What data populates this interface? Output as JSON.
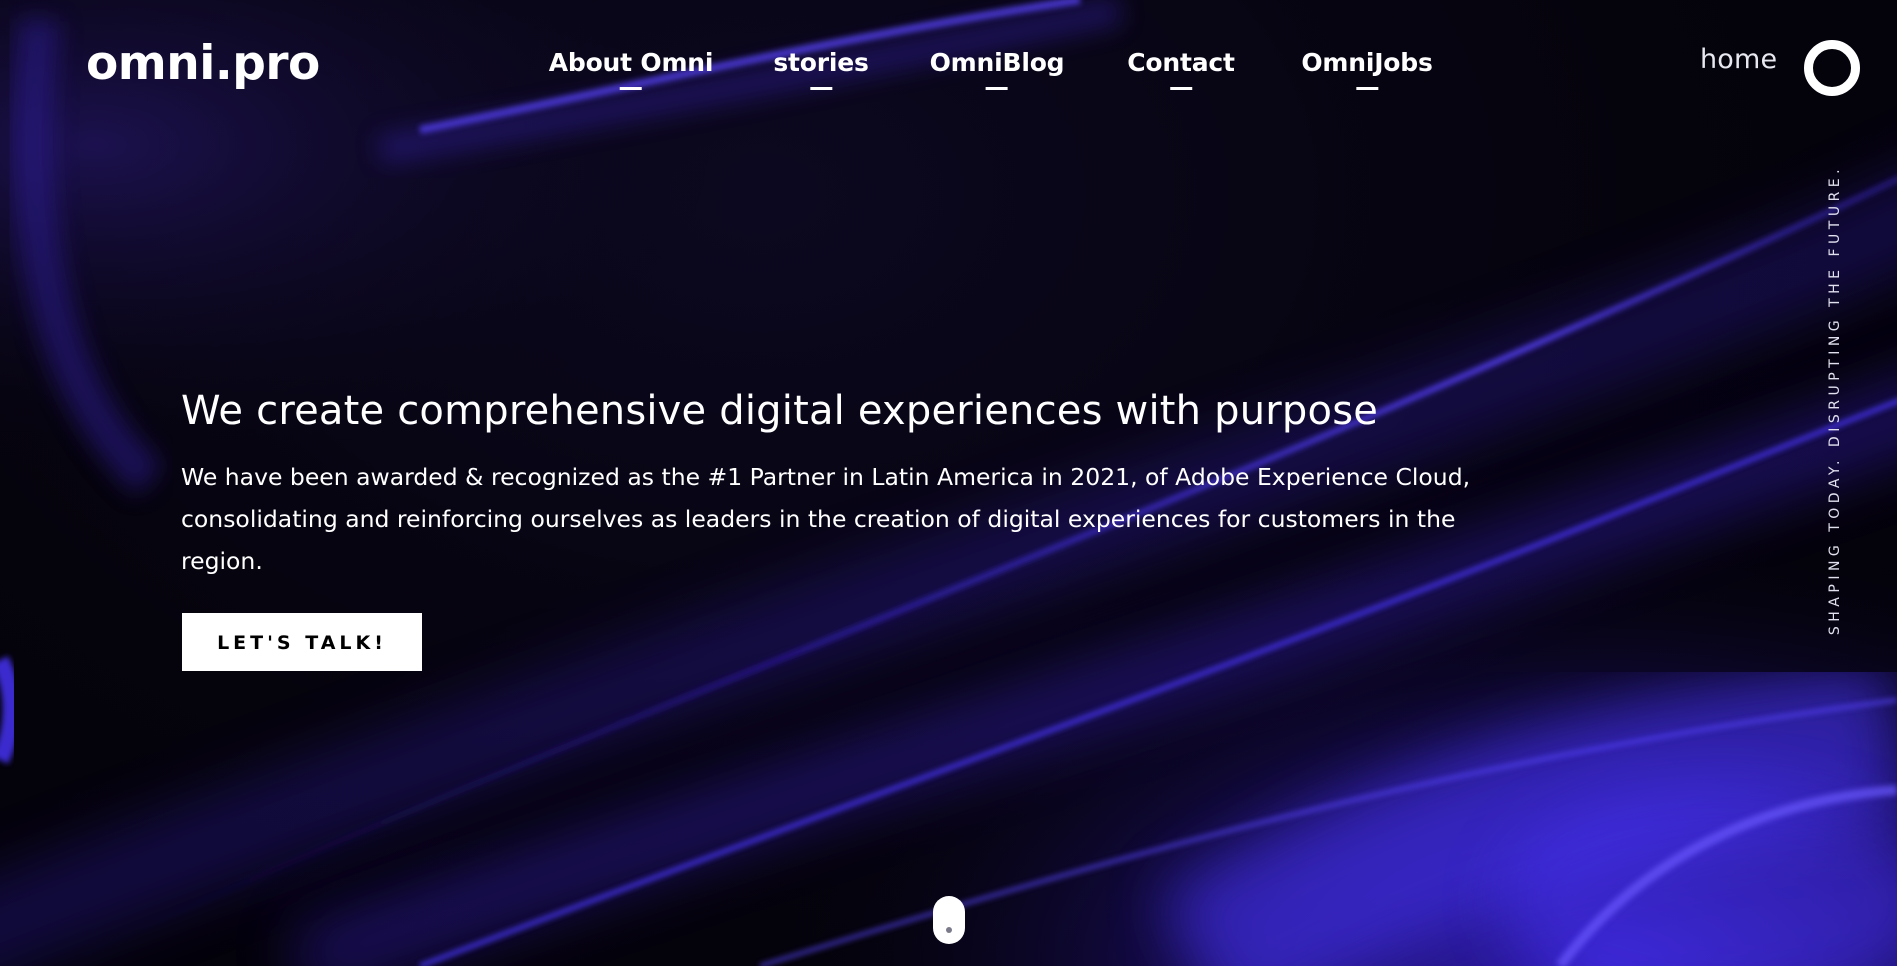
{
  "brand": {
    "logo_text": "omni.pro"
  },
  "nav": {
    "items": [
      {
        "label": "About Omni"
      },
      {
        "label": "stories"
      },
      {
        "label": "OmniBlog"
      },
      {
        "label": "Contact"
      },
      {
        "label": "OmniJobs"
      }
    ]
  },
  "header": {
    "home_label": "home",
    "menu_icon": "ring-menu-icon"
  },
  "hero": {
    "title": "We create comprehensive digital experiences with purpose",
    "description": "We have been awarded & recognized as the #1 Partner in Latin America in 2021, of Adobe Experience Cloud, consolidating and reinforcing ourselves as leaders in the creation of digital experiences for customers in the region.",
    "cta_label": "LET'S TALK!"
  },
  "side": {
    "tagline": "SHAPING TODAY. DISRUPTING THE FUTURE."
  },
  "scroll": {
    "icon": "mouse-scroll-icon"
  },
  "colors": {
    "background": "#05030c",
    "accent": "#4b35ff",
    "text": "#ffffff"
  }
}
